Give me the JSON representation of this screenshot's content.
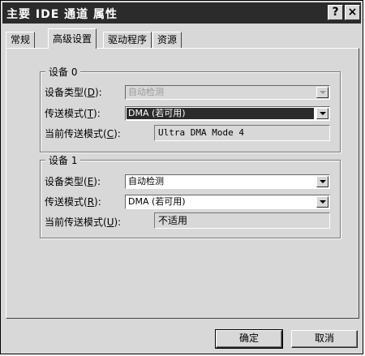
{
  "window": {
    "title": "主要 IDE 通道 属性",
    "help_button": "?",
    "close_button": "×"
  },
  "tabs": [
    {
      "label": "常规",
      "active": false
    },
    {
      "label": "高级设置",
      "active": true
    },
    {
      "label": "驱动程序",
      "active": false
    },
    {
      "label": "资源",
      "active": false
    }
  ],
  "device0": {
    "title": "设备 0",
    "device_type_label": "设备类型(",
    "device_type_key": "D",
    "device_type_suffix": "):",
    "device_type_value": "自动检测",
    "device_type_enabled": false,
    "transfer_label": "传送模式(",
    "transfer_key": "T",
    "transfer_suffix": "):",
    "transfer_value": "DMA (若可用)",
    "current_label": "当前传送模式(",
    "current_key": "C",
    "current_suffix": "):",
    "current_value": "Ultra DMA Mode 4"
  },
  "device1": {
    "title": "设备 1",
    "device_type_label": "设备类型(",
    "device_type_key": "E",
    "device_type_suffix": "):",
    "device_type_value": "自动检测",
    "transfer_label": "传送模式(",
    "transfer_key": "R",
    "transfer_suffix": "):",
    "transfer_value": "DMA (若可用)",
    "current_label": "当前传送模式(",
    "current_key": "U",
    "current_suffix": "):",
    "current_value": "不适用"
  },
  "buttons": {
    "ok": "确定",
    "cancel": "取消"
  },
  "colors": {
    "titlebar": "#2b2b2b",
    "face": "#d8d8d8",
    "selection": "#2b2b2b"
  }
}
